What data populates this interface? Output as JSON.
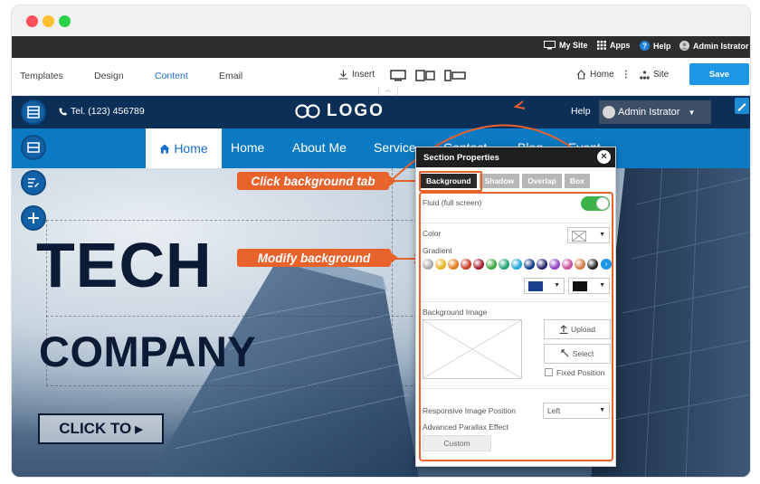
{
  "topbar": {
    "my_site": "My Site",
    "apps": "Apps",
    "help": "Help",
    "admin": "Admin Istrator"
  },
  "editor": {
    "tabs": [
      "Templates",
      "Design",
      "Content",
      "Email"
    ],
    "active_tab": "Content",
    "insert_label": "Insert",
    "home_label": "Home",
    "site_label": "Site",
    "save_label": "Save",
    "accent": "#1b97e6"
  },
  "site": {
    "tel": "Tel. (123) 456789",
    "logo": "LOGO",
    "help": "Help",
    "admin": "Admin Istrator",
    "nav": [
      "Home",
      "Home",
      "About Me",
      "Service",
      "Contact",
      "Blog",
      "Event"
    ],
    "headline": "TECH",
    "subheadline": "COMPANY",
    "cta": "CLICK TO",
    "header_color": "#0c2f57",
    "nav_color": "#0b7ac2"
  },
  "callouts": {
    "background_tab": "Click background tab",
    "modify": "Modify background",
    "color": "#e8622c"
  },
  "panel": {
    "title": "Section Properties",
    "tabs": [
      "Background",
      "Shadow",
      "Overlap",
      "Box"
    ],
    "active_tab": "Background",
    "fluid_label": "Fluid (full screen)",
    "fluid_on": true,
    "color_label": "Color",
    "gradient_label": "Gradient",
    "gradient_swatches": [
      "#a9a9a9",
      "#e4b21c",
      "#e07b1a",
      "#c63a23",
      "#a3192b",
      "#3aa63c",
      "#1e9f73",
      "#1fa6d6",
      "#0f3a8a",
      "#23236b",
      "#8e3fc2",
      "#c94a9e",
      "#d17a44",
      "#222222"
    ],
    "primary_color": "#1b3f8f",
    "secondary_color": "#111111",
    "bg_image_label": "Background Image",
    "upload_label": "Upload",
    "select_label": "Select",
    "fixed_position_label": "Fixed Position",
    "responsive_label": "Responsive Image Position",
    "responsive_value": "Left",
    "parallax_label": "Advanced Parallax Effect",
    "custom_label": "Custom"
  }
}
